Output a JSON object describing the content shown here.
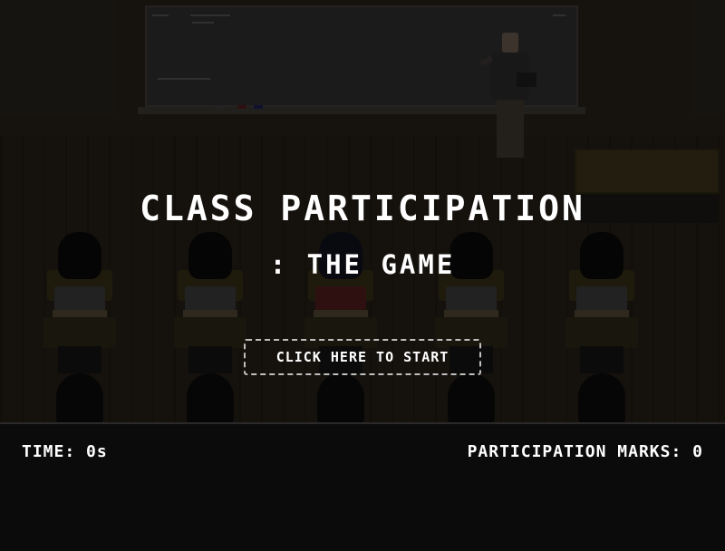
{
  "game": {
    "title": "CLASS PARTICIPATION",
    "subtitle": ": THE GAME",
    "start_button_label": "CLICK HERE TO START"
  },
  "hud": {
    "time_label": "TIME:",
    "time_value": "0s",
    "marks_label": "PARTICIPATION MARKS:",
    "marks_value": "0"
  },
  "scene": {
    "student_count": 5,
    "active_student_index": 2,
    "colors": {
      "text": "#ffffff",
      "button_border": "#bfbfbf",
      "hud_background": "#0b0b0b",
      "scene_background": "#15130f"
    },
    "icons": [
      "whiteboard",
      "teacher-sprite",
      "student-sprite",
      "cabinet"
    ]
  }
}
